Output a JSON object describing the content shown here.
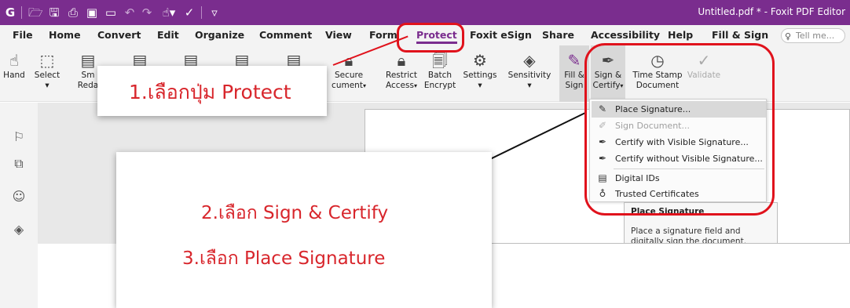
{
  "titlebar": {
    "title": "Untitled.pdf * - Foxit PDF Editor",
    "quick_access": [
      "app-logo-icon",
      "open-folder-icon",
      "save-icon",
      "print-icon",
      "scan-icon",
      "new-doc-icon",
      "undo-icon",
      "redo-icon",
      "hand-select-icon",
      "check-icon",
      "customize-icon"
    ]
  },
  "menu": {
    "items": [
      "File",
      "Home",
      "Convert",
      "Edit",
      "Organize",
      "Comment",
      "View",
      "Form",
      "Protect",
      "Foxit eSign",
      "Share",
      "Accessibility",
      "Help",
      "Fill & Sign"
    ],
    "active": "Protect",
    "tellme_placeholder": "Tell me..."
  },
  "ribbon": {
    "hand": "Hand",
    "select": "Select",
    "smart_redact_line1": "Sm",
    "smart_redact_line2": "Reda",
    "secure_line1": "Secure",
    "secure_line2": "cument",
    "restrict_line1": "Restrict",
    "restrict_line2": "Access",
    "batch_line1": "Batch",
    "batch_line2": "Encrypt",
    "settings": "Settings",
    "sensitivity": "Sensitivity",
    "fill_line1": "Fill &",
    "fill_line2": "Sign",
    "sign_certify_line1": "Sign &",
    "sign_certify_line2": "Certify",
    "timestamp_line1": "Time Stamp",
    "timestamp_line2": "Document",
    "validate": "Validate",
    "caret": "▾"
  },
  "dropdown": {
    "place_signature": "Place Signature...",
    "sign_document": "Sign Document...",
    "certify_visible": "Certify with Visible Signature...",
    "certify_invisible": "Certify without Visible Signature...",
    "digital_ids": "Digital IDs",
    "trusted_certificates": "Trusted Certificates"
  },
  "tooltip": {
    "title": "Place Signature",
    "body": "Place a signature field and digitally sign the document."
  },
  "annotations": {
    "step1": "1.เลือกปุ่ม Protect",
    "step2": "2.เลือก Sign & Certify",
    "step3": "3.เลือก Place Signature",
    "accent_color": "#e0121c",
    "text_color": "#d8262c"
  },
  "theme": {
    "titlebar_color": "#7a2d8e"
  }
}
